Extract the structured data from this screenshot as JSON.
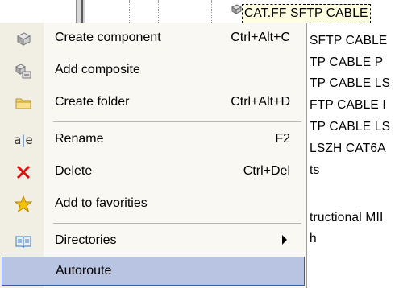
{
  "background": {
    "tree_items": [
      {
        "text": "CAT.FF SFTP CABLE",
        "selected": true
      },
      {
        "text": "SFTP CABLE"
      },
      {
        "text": "TP CABLE P"
      },
      {
        "text": "TP CABLE LS"
      },
      {
        "text": "FTP CABLE I"
      },
      {
        "text": "TP CABLE LS"
      },
      {
        "text": "LSZH CAT6A"
      },
      {
        "text": "ts"
      },
      {
        "text": ""
      },
      {
        "text": "tructional MII"
      },
      {
        "text": "h"
      }
    ]
  },
  "menu": {
    "items": [
      {
        "label": "Create component",
        "shortcut": "Ctrl+Alt+C",
        "icon": "cube-icon"
      },
      {
        "label": "Add composite",
        "shortcut": "",
        "icon": "composite-icon"
      },
      {
        "label": "Create folder",
        "shortcut": "Ctrl+Alt+D",
        "icon": "folder-icon"
      },
      {
        "label": "Rename",
        "shortcut": "F2",
        "icon": "rename-icon"
      },
      {
        "label": "Delete",
        "shortcut": "Ctrl+Del",
        "icon": "delete-icon"
      },
      {
        "label": "Add to favorities",
        "shortcut": "",
        "icon": "star-icon"
      },
      {
        "label": "Directories",
        "shortcut": "",
        "icon": "book-icon",
        "submenu": true
      },
      {
        "label": "Autoroute",
        "shortcut": "",
        "icon": "",
        "highlighted": true
      }
    ]
  },
  "colors": {
    "menu_bg": "#f9f8f3",
    "highlight_bg": "#b9c4e2",
    "highlight_border": "#3b58a8",
    "delete_red": "#e01010",
    "star_gold": "#f2c200",
    "folder_yellow": "#f5d76e",
    "book_blue": "#3a78c8"
  }
}
